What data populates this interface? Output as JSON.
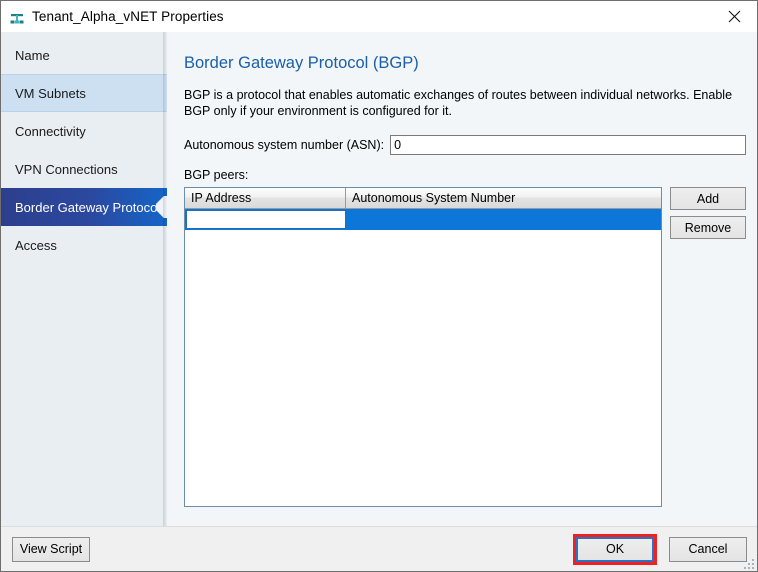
{
  "window": {
    "title": "Tenant_Alpha_vNET Properties",
    "icon": "network-vnet-icon",
    "close_icon": "close-icon"
  },
  "sidebar": {
    "items": [
      {
        "label": "Name",
        "state": "normal"
      },
      {
        "label": "VM Subnets",
        "state": "hover"
      },
      {
        "label": "Connectivity",
        "state": "normal"
      },
      {
        "label": "VPN Connections",
        "state": "normal"
      },
      {
        "label": "Border Gateway Protocol...",
        "state": "selected"
      },
      {
        "label": "Access",
        "state": "normal"
      }
    ]
  },
  "main": {
    "heading": "Border Gateway Protocol (BGP)",
    "description": "BGP is a protocol that enables automatic exchanges of routes between individual networks. Enable BGP only if your environment is configured for it.",
    "asn": {
      "label": "Autonomous system number (ASN):",
      "value": "0",
      "placeholder": ""
    },
    "peers_label": "BGP peers:",
    "table": {
      "columns": [
        "IP Address",
        "Autonomous System Number"
      ],
      "rows": [
        {
          "ip_address": "",
          "asn": "",
          "selected": true,
          "editing": true
        }
      ]
    },
    "side_buttons": {
      "add_label": "Add",
      "remove_label": "Remove"
    }
  },
  "footer": {
    "view_script_label": "View Script",
    "ok_label": "OK",
    "cancel_label": "Cancel"
  },
  "colors": {
    "accent_blue": "#0c77d8",
    "heading_blue": "#1c5fa8",
    "selected_nav": "#2b49a0",
    "hover_nav": "#cde0f2",
    "annotation_red": "#ee2222",
    "icon_teal": "#2e9a9a"
  }
}
